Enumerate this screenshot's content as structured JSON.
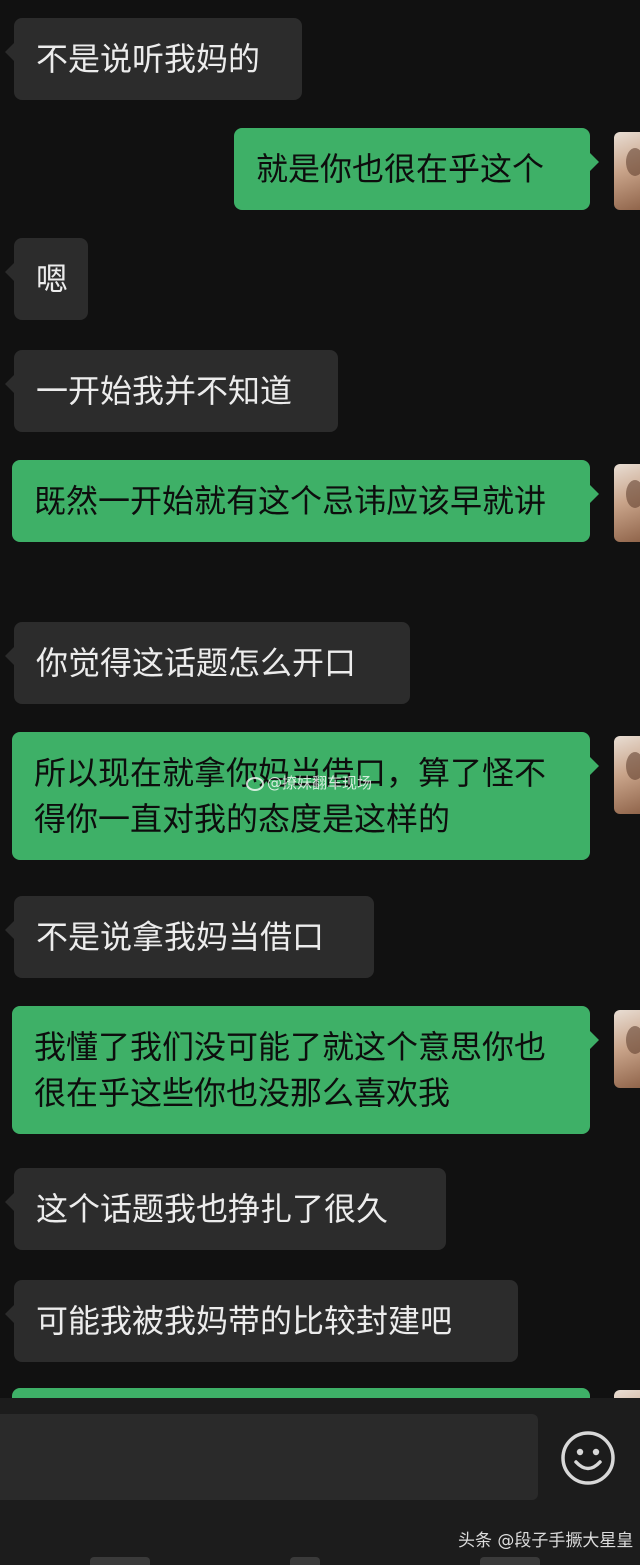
{
  "messages": [
    {
      "side": "in",
      "text": "不是说听我妈的"
    },
    {
      "side": "out",
      "text": "就是你也很在乎这个"
    },
    {
      "side": "in",
      "text": "嗯"
    },
    {
      "side": "in",
      "text": "一开始我并不知道"
    },
    {
      "side": "out",
      "text": "既然一开始就有这个忌讳应该早就讲"
    },
    {
      "side": "in",
      "text": "你觉得这话题怎么开口"
    },
    {
      "side": "out",
      "text": "所以现在就拿你妈当借口，算了怪不得你一直对我的态度是这样的"
    },
    {
      "side": "in",
      "text": "不是说拿我妈当借口"
    },
    {
      "side": "out",
      "text": "我懂了我们没可能了就这个意思你也很在乎这些你也没那么喜欢我"
    },
    {
      "side": "in",
      "text": "这个话题我也挣扎了很久"
    },
    {
      "side": "in",
      "text": "可能我被我妈带的比较封建吧"
    }
  ],
  "watermark": "@撩妹翻车现场",
  "footer_credit": "头条 @段子手撅大星皇",
  "icons": {
    "emoji": "smiley-face-icon",
    "avatar": "contact-avatar"
  },
  "colors": {
    "background": "#111111",
    "incoming_bubble": "#2c2c2c",
    "outgoing_bubble": "#3eb067",
    "input_bar": "#1c1c1c"
  }
}
